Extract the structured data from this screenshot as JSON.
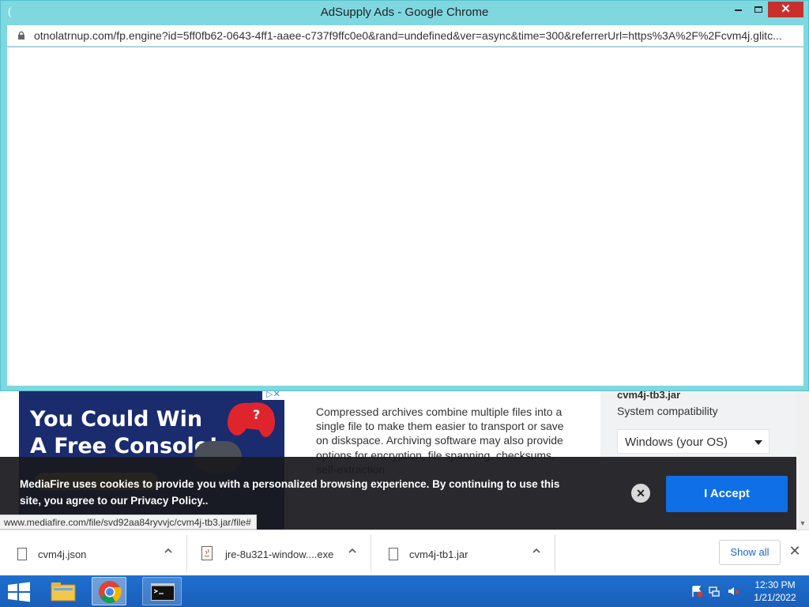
{
  "popup": {
    "title": "AdSupply Ads - Google Chrome",
    "url": "otnolatrnup.com/fp.engine?id=5ff0fb62-0643-4ff1-aaee-c737f9ffc0e0&rand=undefined&ver=async&time=300&referrerUrl=https%3A%2F%2Fcvm4j.glitc...",
    "close_glyph": "✕",
    "minimize_glyph": "▬"
  },
  "background": {
    "ad": {
      "headline": "You Could Win\nA Free Console!",
      "badge": "▷✕"
    },
    "article_paragraphs": [
      "Compressed archives combine multiple files into a single file to make them easier to transport or save on diskspace. Archiving software may also provide options for encryption, file spanning, checksums, self-extraction"
    ],
    "sidebar": {
      "filename": "cvm4j-tb3.jar",
      "compat_label": "System compatibility",
      "os_select_value": "Windows (your OS)"
    }
  },
  "cookie_banner": {
    "text": "MediaFire uses cookies to provide you with a personalized browsing experience. By continuing to use this site, you agree to our Privacy Policy..",
    "close_glyph": "✕",
    "accept_label": "I Accept"
  },
  "status_url": "www.mediafire.com/file/svd92aa84ryvvjc/cvm4j-tb3.jar/file#",
  "downloads": {
    "items": [
      {
        "name": "cvm4j.json",
        "icon": "file-icon"
      },
      {
        "name": "jre-8u321-window....exe",
        "icon": "java-file-icon"
      },
      {
        "name": "cvm4j-tb1.jar",
        "icon": "file-icon"
      }
    ],
    "show_all_label": "Show all",
    "close_glyph": "✕"
  },
  "taskbar": {
    "time": "12:30 PM",
    "date": "1/21/2022",
    "apps": [
      "file-explorer-icon",
      "chrome-icon",
      "command-prompt-icon"
    ]
  },
  "colors": {
    "popup_frame": "#7fd8e0",
    "accept_button": "#0f6fe6",
    "taskbar": "#1e6fd0",
    "ad_background": "#1a2b6e"
  }
}
